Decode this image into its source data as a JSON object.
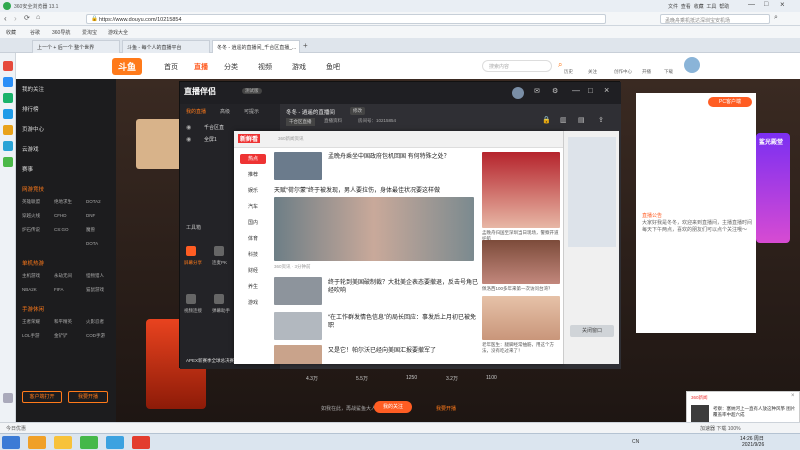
{
  "browser": {
    "title": "360安全浏览器 13.1",
    "url": "https://www.douyu.com/10215854",
    "menu": [
      "文件",
      "查看",
      "收藏",
      "工具",
      "帮助"
    ],
    "search_placeholder": "孟晚舟乘机抵达深圳宝安机场"
  },
  "bookmarks": [
    "收藏",
    "谷歌",
    "360导航",
    "爱淘宝",
    "游戏大全"
  ],
  "tabs": [
    {
      "label": "上一个 + 后一个 整个世界"
    },
    {
      "label": "斗鱼 - 每个人的直播平台"
    },
    {
      "label": "冬冬 - 逍遥的直播间_千合区直播_..."
    }
  ],
  "douyu": {
    "logo": "斗鱼",
    "nav": [
      "首页",
      "直播",
      "分类",
      "视频",
      "游戏",
      "鱼吧"
    ],
    "search_placeholder": "搜索内容",
    "header_icons": [
      "历史",
      "关注",
      "创作中心",
      "开播",
      "下载"
    ],
    "sidebar": {
      "top_items": [
        "我的关注",
        "排行榜",
        "页游中心",
        "云游戏",
        "赛事"
      ],
      "sections": [
        {
          "title": "网游竞技",
          "games": [
            "英雄联盟",
            "绝地求生",
            "DOTA2",
            "穿越火线",
            "CFHD",
            "DNF",
            "炉石传说",
            "CS:GO",
            "魔兽",
            "DOTA"
          ]
        },
        {
          "title": "单机热游",
          "games": [
            "主机游戏",
            "永劫无间",
            "怪物猎人",
            "NBA2K",
            "FIFA",
            "猫鼠游戏"
          ]
        },
        {
          "title": "手游休闲",
          "games": [
            "王者荣耀",
            "和平精英",
            "火影忍者",
            "LOL手游",
            "金铲铲",
            "COD手游"
          ]
        }
      ],
      "btn_open": "客户端打开",
      "btn_live": "我要开播"
    },
    "right_panel": {
      "badge": "PC客户端",
      "title_lines": [
        "直播公告",
        "大家好我是冬冬，欢迎来到直播间，主播直播时间每天下午两点，喜欢的朋友们可以点个关注哦～"
      ],
      "ad": "鲨光殿堂"
    },
    "room_stats": [
      "4.3万",
      "5.5万",
      "1250",
      "3.2万",
      "1100"
    ],
    "room_bottom": [
      "如我在此，再战鲨鱼大人",
      "我的关注",
      "我要开播"
    ]
  },
  "streamer_app": {
    "title": "直播伴侣",
    "badge": "测试版",
    "left_tabs": [
      "我的直播",
      "高级",
      "可提示"
    ],
    "room_title": "冬冬 - 逍遥的直播间",
    "room_tag": "修改",
    "room_meta": [
      "千合区直播",
      "直播资料",
      "房间号：10215854"
    ],
    "scenes": [
      "千合区直",
      "全屏1"
    ],
    "tools_title": "工具箱",
    "tools": [
      "屏幕分享",
      "连麦PK",
      "直播礼",
      "视频连接",
      "弹幕助手",
      "导出"
    ],
    "footer": "APEX新赛季全球总决赛"
  },
  "news": {
    "logo": "新鲜看",
    "logo_sub": "360新闻资讯",
    "categories": [
      "热点",
      "推荐",
      "娱乐",
      "汽车",
      "国内",
      "体育",
      "科技",
      "财经",
      "养生",
      "游戏"
    ],
    "items": [
      {
        "title": "孟晚舟乘坐中国政府包机回国 有何特殊之处？",
        "source": ""
      },
      {
        "title": "天赋“荷尔蒙”终于被发现，男人要拉伤，身体最佳状况要这样做",
        "source": ""
      },
      {
        "title": "",
        "source": "360资讯 · 3分钟前"
      },
      {
        "title": "终于轮到美国破制裁？大批美企表态要撤退，反击号角已经吹响",
        "source": ""
      },
      {
        "title": "“在工作群发情色信息”的局长回应：事发后上月初已被免职",
        "source": ""
      },
      {
        "title": "又是它！帕尔沃已经向美国汇报要撤军了",
        "source": ""
      }
    ],
    "side_captions": [
      "孟晚舟归国至深圳当日现场，警察开道护航",
      "佩洛西100多年来第一次访问台湾？",
      "老年医生：腿脚经常抽筋，用这个方法，没有吃过来了！"
    ]
  },
  "side_window": {
    "button": "关闭窗口"
  },
  "toast": {
    "app": "360新闻",
    "title": "考察：塞纳河上一直有人放这种风筝 图片覆盖率中超六成"
  },
  "statusbar": {
    "left": "今日优惠",
    "right": "加速器  下载  100%"
  },
  "taskbar": {
    "time": "14:26 周日",
    "date": "2021/9/26",
    "lang": "CN"
  }
}
